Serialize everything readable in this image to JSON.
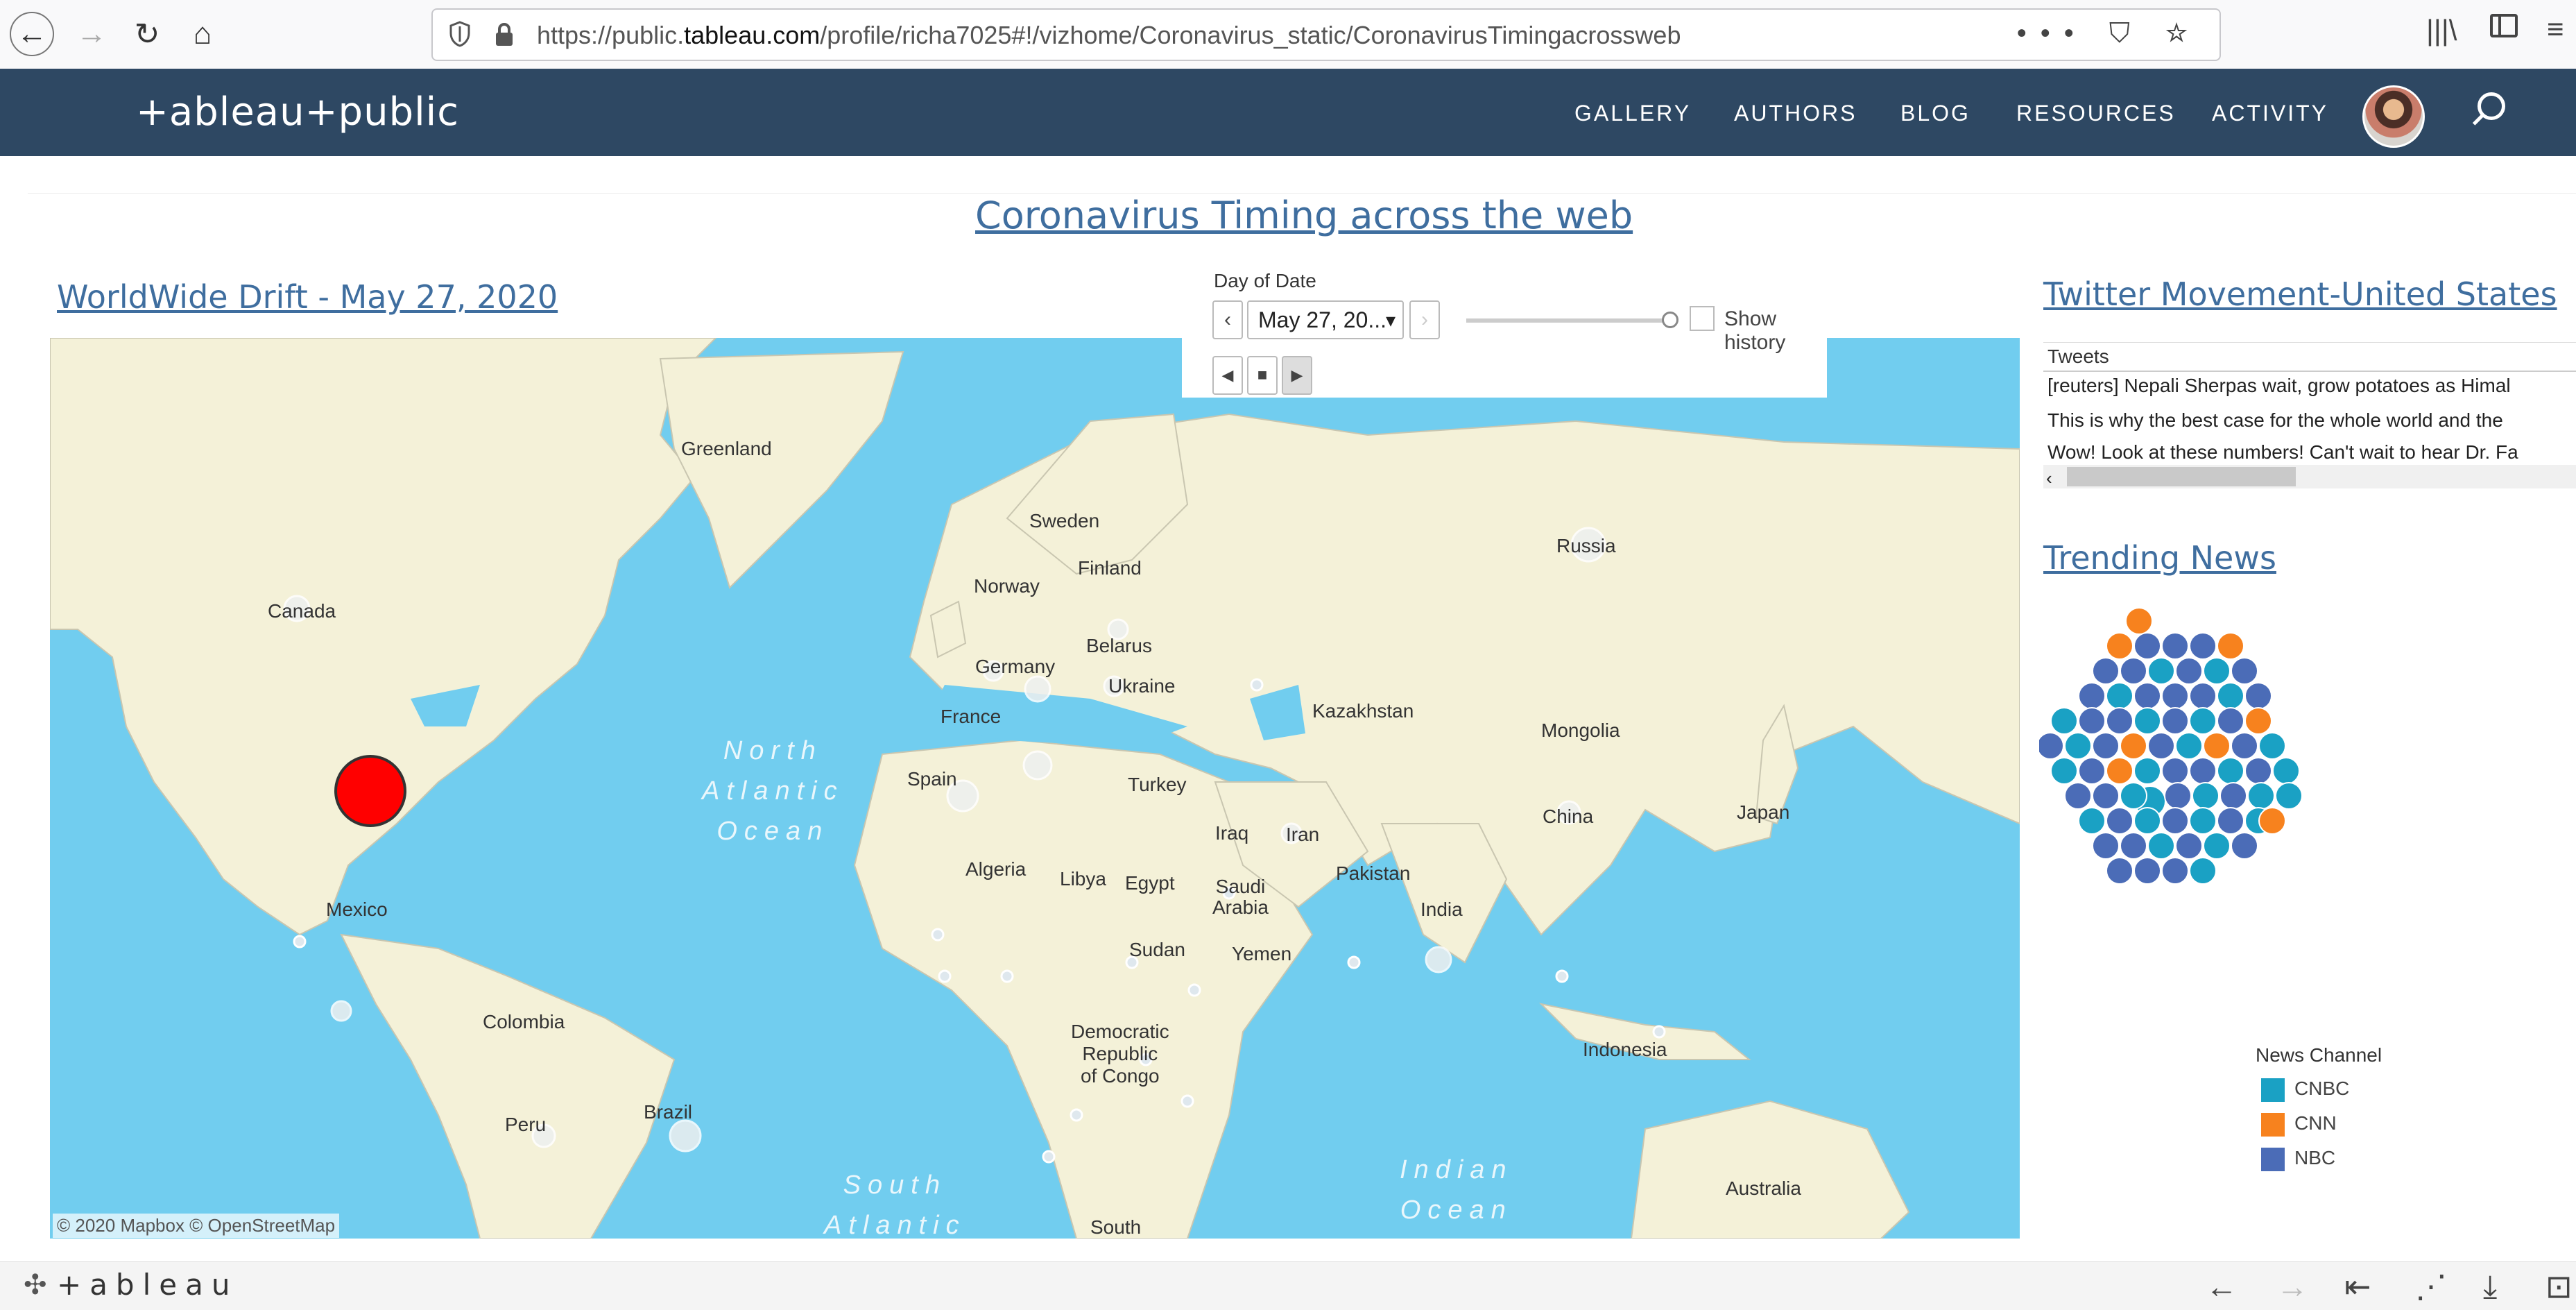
{
  "browser": {
    "url_prefix": "https://public.",
    "url_domain": "tableau.com",
    "url_path": "/profile/richa7025#!/vizhome/Coronavirus_static/CoronavirusTimingacrossweb",
    "actions": "••• ⛉ ☆",
    "library": "|||\\"
  },
  "header": {
    "logo": "+ableau+public",
    "nav": [
      "GALLERY",
      "AUTHORS",
      "BLOG",
      "RESOURCES",
      "ACTIVITY"
    ]
  },
  "dashboard": {
    "title": "Coronavirus Timing across the web",
    "map_title": "WorldWide Drift - May 27, 2020",
    "map_attribution": "© 2020 Mapbox © OpenStreetMap",
    "map_labels": {
      "greenland": "Greenland",
      "canada": "Canada",
      "mexico": "Mexico",
      "colombia": "Colombia",
      "brazil": "Brazil",
      "peru": "Peru",
      "sweden": "Sweden",
      "finland": "Finland",
      "norway": "Norway",
      "belarus": "Belarus",
      "germany": "Germany",
      "ukraine": "Ukraine",
      "france": "France",
      "spain": "Spain",
      "turkey": "Turkey",
      "russia": "Russia",
      "kazakhstan": "Kazakhstan",
      "mongolia": "Mongolia",
      "china": "China",
      "japan": "Japan",
      "iraq": "Iraq",
      "iran": "Iran",
      "pakistan": "Pakistan",
      "india": "India",
      "saudi": "Saudi\nArabia",
      "yemen": "Yemen",
      "algeria": "Algeria",
      "libya": "Libya",
      "egypt": "Egypt",
      "sudan": "Sudan",
      "drc": "Democratic\nRepublic\nof Congo",
      "indonesia": "Indonesia",
      "australia": "Australia",
      "south": "South",
      "north_atlantic": "North\nAtlantic\nOcean",
      "south_atlantic": "South\nAtlantic",
      "indian_ocean": "Indian\nOcean"
    },
    "date_filter": {
      "label": "Day of Date",
      "value": "May 27, 20...",
      "show_history": "Show history"
    },
    "twitter_title": "Twitter Movement-United States",
    "tweets": {
      "header": "Tweets",
      "rows": [
        "[reuters] Nepali Sherpas wait, grow potatoes as Himal",
        "This  is why  the best case for the whole world and the",
        "Wow! Look at these numbers! Can't wait to hear Dr. Fa"
      ]
    },
    "trending_title": "Trending News",
    "legend": {
      "title": "News Channel",
      "items": [
        {
          "label": "CNBC",
          "color": "#1aa1c4"
        },
        {
          "label": "CNN",
          "color": "#f7821e"
        },
        {
          "label": "NBC",
          "color": "#4b6cb7"
        }
      ]
    }
  },
  "footer": {
    "logo": "+ableau",
    "tools": [
      "←",
      "→",
      "⇤",
      "⋰",
      "⤓",
      "⊡"
    ]
  }
}
